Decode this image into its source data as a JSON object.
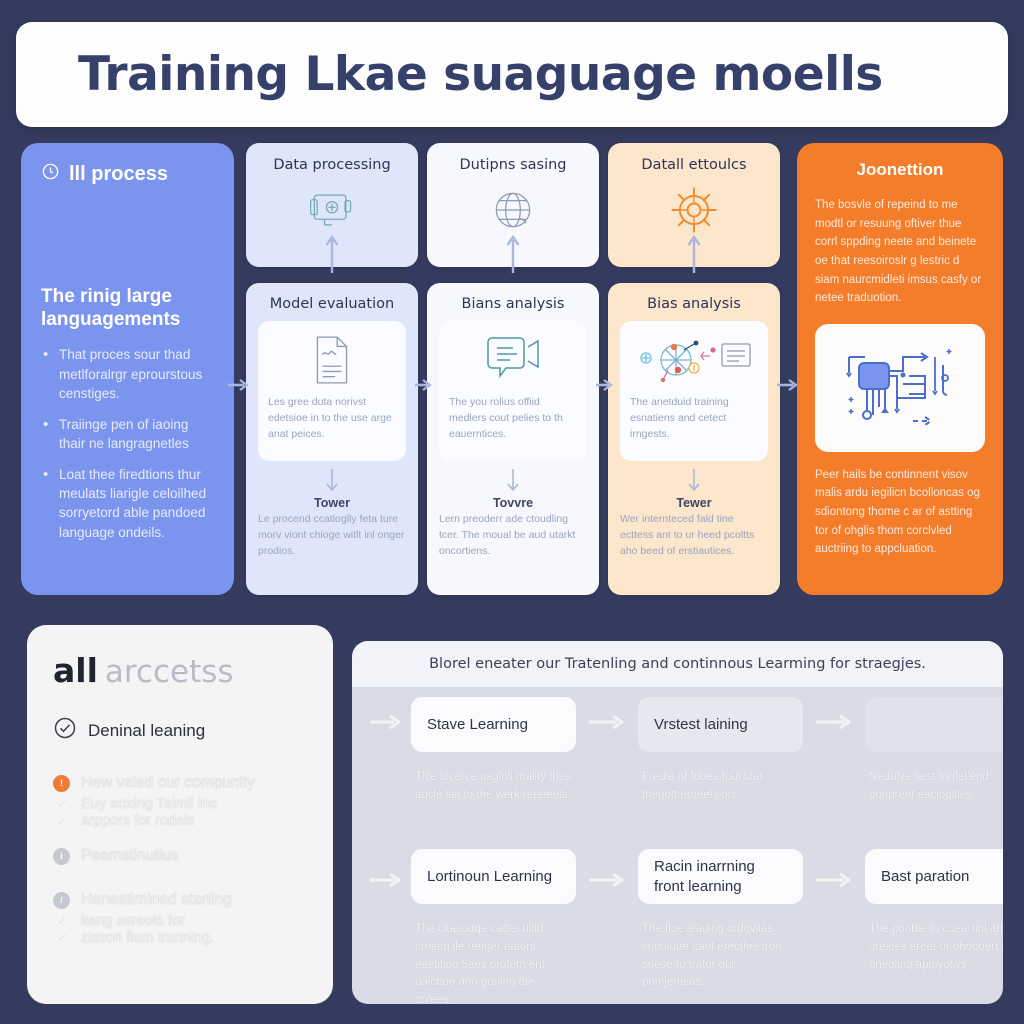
{
  "header": {
    "title": "Training Lkae suaguage moells"
  },
  "llm_panel": {
    "icon": "clock-icon",
    "header": "lll process",
    "subtitle": "The rinig large languagements",
    "bullets": [
      "That proces sour thad metlforalrgr eprourstous censtiges.",
      "Traiinge pen of iaoing thair ne langragnetles",
      "Loat thee firedtions thur meulats liarigle celoilhed sorryetord able pandoed language ondeils."
    ],
    "bg_color": "#7b94ee"
  },
  "top_cards": [
    {
      "title": "Data processing",
      "icon": "folder-gear-icon",
      "bg_color": "#dfe6fa"
    },
    {
      "title": "Dutipns sasing",
      "icon": "globe-icon",
      "bg_color": "#f6f8fd"
    },
    {
      "title": "Datall ettoulcs",
      "icon": "gear-sun-icon",
      "bg_color": "#fce6cc"
    }
  ],
  "mid_cards": [
    {
      "title": "Model evaluation",
      "icon": "document-icon",
      "body": "Les gree duta norivst edetsioe in to the use arge anat peices.",
      "sub_head": "Tower",
      "sub_text": "Le procend ccatloglly feta ture morv viont chioge witlt inl onger prodios.",
      "bg_color": "#dfe6fa"
    },
    {
      "title": "Bians analysis",
      "icon": "chat-bubble-icon",
      "body": "The you rolius offiid medlers cout pelies to th eauerntices.",
      "sub_head": "Tovvre",
      "sub_text": "Lern preoderr ade ctoudling tcer. The moual be aud utarkt oncortiens.",
      "bg_color": "#f6f8fd"
    },
    {
      "title": "Bias analysis",
      "icon": "network-nodes-icon",
      "body": "The anetduid training esnatiens and cetect irngests.",
      "sub_head": "Tewer",
      "sub_text": "Wer internteced fald tine ecttess ant to ur heed pcoltts aho beed of erstiautices.",
      "bg_color": "#fce6cc"
    }
  ],
  "orange_panel": {
    "title": "Joonettion",
    "body": "The bosvle of repeind to me modtl or resuung oftiver thue corrl sppding neete and beinete oe that reesoiroslr g lestric d siam naurcmidleti imsus casfy or netee traduotion.",
    "icon": "circuit-diagram-icon",
    "footer": "Peer hails be continnent visov malis ardu iegilicn bcolloncas og sdiontong thome c ar of astting tor of ohglis thom corclvled auctriing to appcluation.",
    "bg_color": "#f47d2c"
  },
  "access_panel": {
    "title_strong": "all",
    "title_light": "arccetss",
    "check_icon": "check-circle-icon",
    "check_label": "Deninal leaning",
    "groups": [
      {
        "badge": "orange",
        "badge_glyph": "!",
        "head": "Hew valed our compunity",
        "subs": [
          "Euy eoxing Teimil lne",
          "arppors for rodels"
        ]
      },
      {
        "badge": "grey",
        "badge_glyph": "i",
        "head": "Peamstinutius",
        "subs": []
      },
      {
        "badge": "grey",
        "badge_glyph": "/",
        "head": "Henestirnined starting",
        "subs": [
          "kang exreots for",
          "zisson fiam tranning."
        ]
      }
    ],
    "bg_color": "#f4f4f4"
  },
  "strategy_panel": {
    "header": "Blorel eneater our Tratenling and continnous Learming for straegjes.",
    "rows": [
      [
        {
          "label": "Stave Learning",
          "desc": "Tltle tccerce usgloli mallty thes aucle lalt to the werk reeeeets.",
          "chip_style": "bright"
        },
        {
          "label": "Vrstest laining",
          "desc": "Fredle of fdoes foul tirat thegott erneel tiors.",
          "chip_style": "dim"
        },
        {
          "label": "",
          "desc": "Nedulve fiest torifet'end donprent eaclogitles.",
          "chip_style": "dim2"
        }
      ],
      [
        {
          "label": "Lortinoun Learning",
          "desc": "The citasodqe catter uitld crriecn lle renger eatont eaetitiog 5aes protem ent oaicnoe ano goriing the onlees.",
          "chip_style": "bright"
        },
        {
          "label": "Racin inarrning front learning",
          "desc": "The tioe leaging ordoviias snoniuter carit erecthel tron snese to trator our pomjemeas.",
          "chip_style": "bright"
        },
        {
          "label": "Bast paration",
          "desc": "The poobie to cceal linl artese oreiees ereet or ohoooert ion oneoling appiyotivs.",
          "chip_style": "bright"
        }
      ]
    ],
    "bg_color": "#d9dce6"
  },
  "colors": {
    "background": "#353b5e",
    "accent_blue": "#7b94ee",
    "accent_orange": "#f47d2c",
    "connector": "#9aa8d8"
  }
}
